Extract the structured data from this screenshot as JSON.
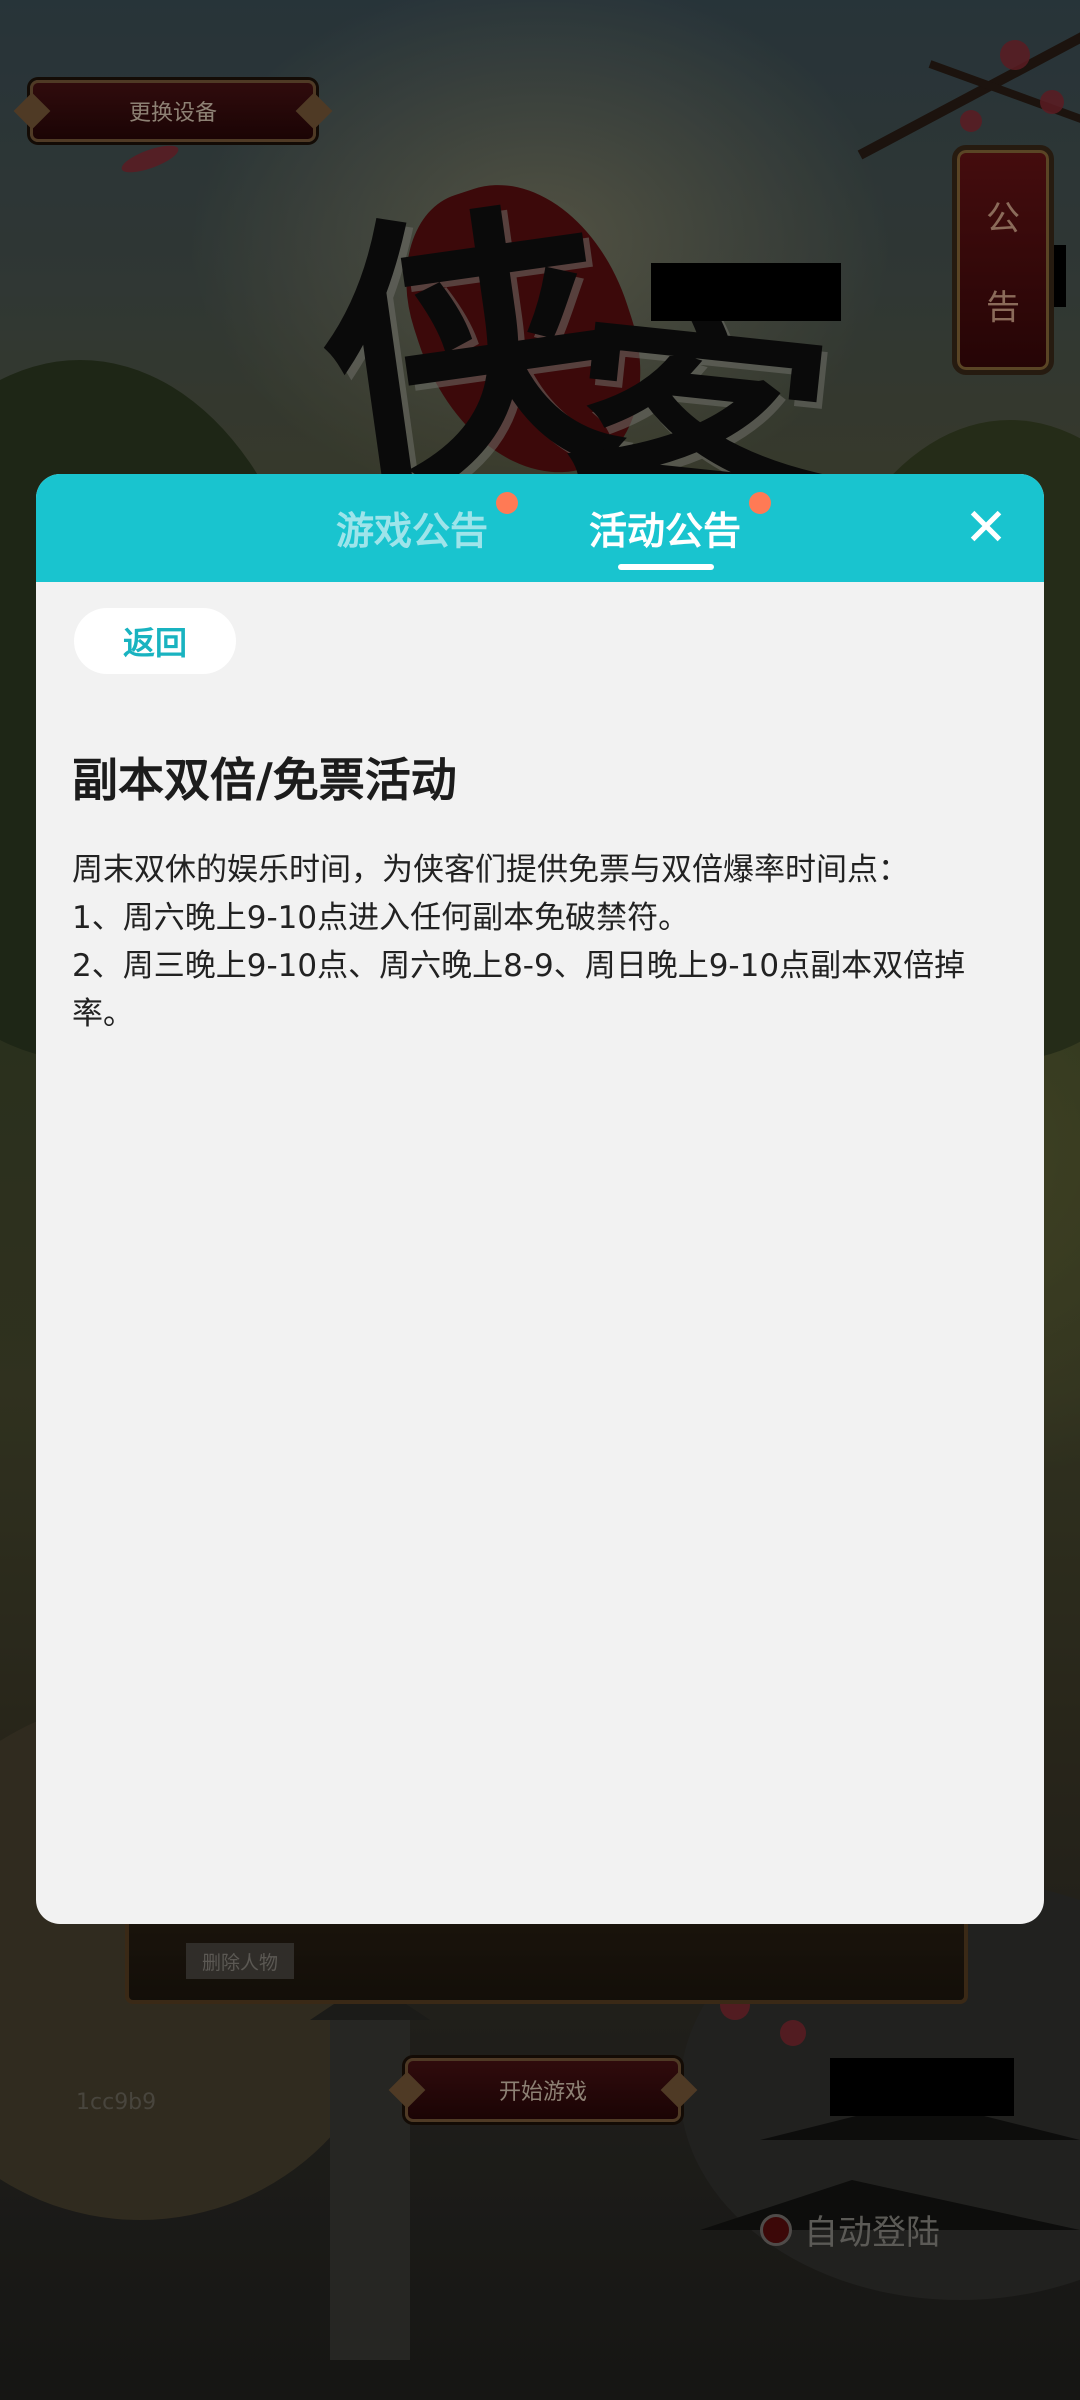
{
  "background": {
    "change_device_label": "更换设备",
    "notice_button": [
      "公",
      "告"
    ],
    "logo_chars": [
      "侠",
      "客"
    ],
    "delete_character_label": "删除人物",
    "start_game_label": "开始游戏",
    "version_code": "1cc9b9",
    "auto_login_label": "自动登陆"
  },
  "modal": {
    "tabs": [
      {
        "label": "游戏公告",
        "has_badge": true,
        "active": false
      },
      {
        "label": "活动公告",
        "has_badge": true,
        "active": true
      }
    ],
    "close_icon": "close-icon",
    "back_label": "返回",
    "article": {
      "title": "副本双倍/免票活动",
      "paragraphs": [
        "周末双休的娱乐时间，为侠客们提供免票与双倍爆率时间点：",
        "1、周六晚上9-10点进入任何副本免破禁符。",
        "2、周三晚上9-10点、周六晚上8-9、周日晚上9-10点副本双倍掉率。"
      ]
    }
  },
  "colors": {
    "header_teal": "#19c4cf",
    "badge_orange": "#ff7a55",
    "modal_bg": "#f2f2f2"
  }
}
